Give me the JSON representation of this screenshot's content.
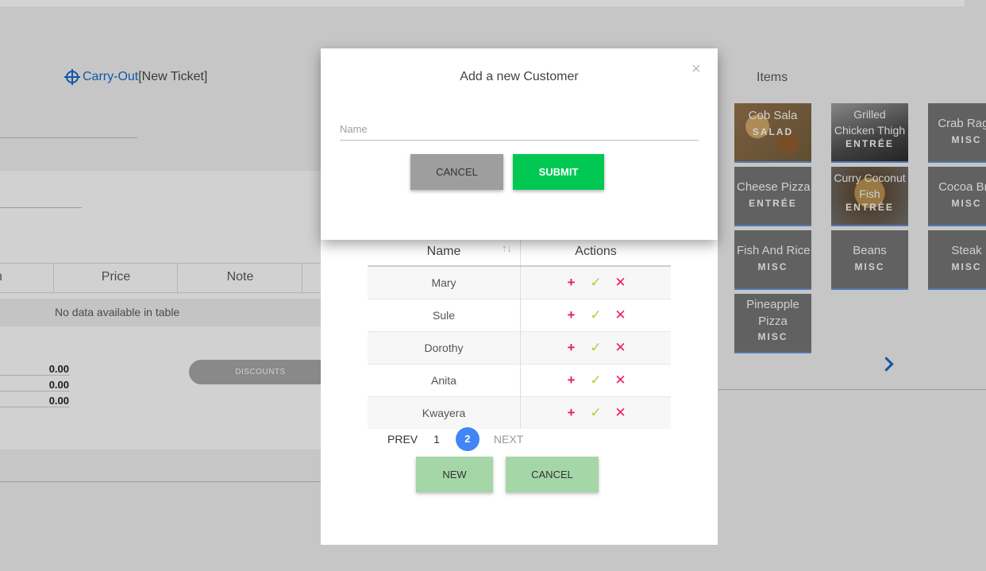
{
  "background": {
    "ticket": {
      "type_link": "Carry-Out",
      "status": "[New Ticket]"
    },
    "grid": {
      "columns": [
        "n",
        "Price",
        "Note"
      ],
      "empty_message": "No data available in table"
    },
    "totals": [
      "0.00",
      "0.00",
      "0.00"
    ],
    "discounts_label": "DISCOUNTS",
    "items": {
      "title": "Items",
      "tiles": [
        {
          "name": "Cob Sala",
          "category": "SALAD"
        },
        {
          "name": "Grilled Chicken Thigh",
          "category": "ENTRÉE"
        },
        {
          "name": "Crab Rago",
          "category": "MISC"
        },
        {
          "name": "Cheese Pizza",
          "category": "ENTRÉE"
        },
        {
          "name": "Curry Coconut Fish",
          "category": "ENTRÉE"
        },
        {
          "name": "Cocoa Bre",
          "category": "MISC"
        },
        {
          "name": "Fish And Rice",
          "category": "MISC"
        },
        {
          "name": "Beans",
          "category": "MISC"
        },
        {
          "name": "Steak",
          "category": "MISC"
        },
        {
          "name": "Pineapple Pizza",
          "category": "MISC"
        }
      ]
    }
  },
  "customer_list": {
    "columns": {
      "name": "Name",
      "actions": "Actions"
    },
    "rows": [
      {
        "name": "Mary"
      },
      {
        "name": "Sule"
      },
      {
        "name": "Dorothy"
      },
      {
        "name": "Anita"
      },
      {
        "name": "Kwayera"
      }
    ],
    "action_icons": {
      "add": "+",
      "select": "✓",
      "delete": "✕"
    },
    "pagination": {
      "prev": "PREV",
      "pages": [
        "1",
        "2"
      ],
      "current": "2",
      "next": "NEXT"
    },
    "new_label": "NEW",
    "cancel_label": "CANCEL"
  },
  "add_customer": {
    "title": "Add a new Customer",
    "close": "×",
    "name_placeholder": "Name",
    "name_value": "",
    "cancel_label": "CANCEL",
    "submit_label": "SUBMIT"
  }
}
